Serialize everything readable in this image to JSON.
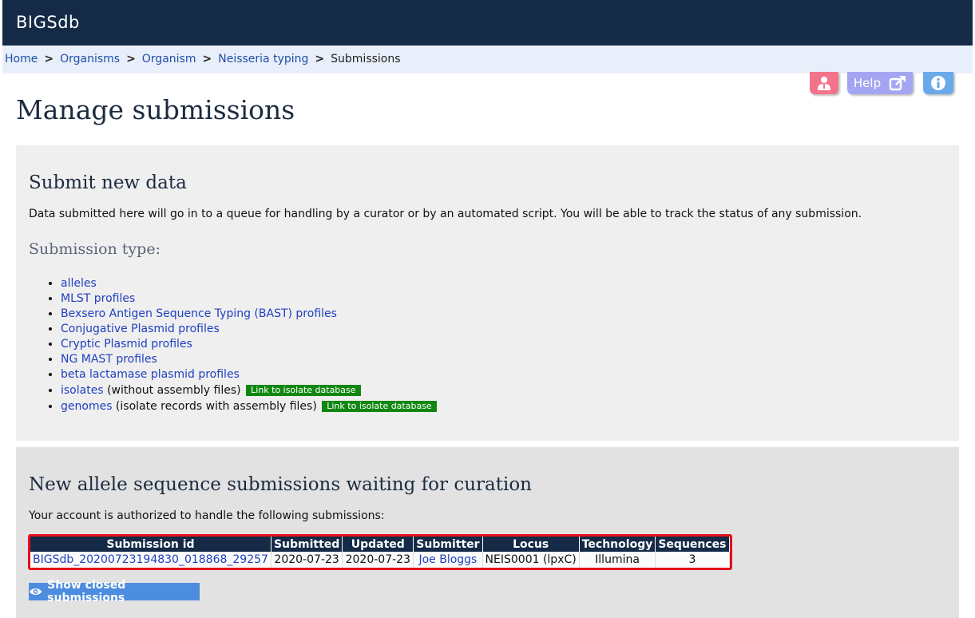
{
  "app": {
    "brand": "BIGSdb"
  },
  "breadcrumb": {
    "items": [
      "Home",
      "Organisms",
      "Organism",
      "Neisseria typing"
    ],
    "current": "Submissions",
    "separator": ">"
  },
  "toolbar": {
    "help_label": "Help",
    "icons": [
      "user-icon",
      "external-link-icon",
      "info-icon"
    ]
  },
  "page": {
    "title": "Manage submissions"
  },
  "submit": {
    "heading": "Submit new data",
    "description": "Data submitted here will go in to a queue for handling by a curator or by an automated script. You will be able to track the status of any submission.",
    "type_heading": "Submission type:",
    "types": [
      {
        "label": "alleles"
      },
      {
        "label": "MLST profiles"
      },
      {
        "label": "Bexsero Antigen Sequence Typing (BAST) profiles"
      },
      {
        "label": "Conjugative Plasmid profiles"
      },
      {
        "label": "Cryptic Plasmid profiles"
      },
      {
        "label": "NG MAST profiles"
      },
      {
        "label": "beta lactamase plasmid profiles"
      },
      {
        "label": "isolates",
        "note": " (without assembly files) ",
        "badge": "Link to isolate database"
      },
      {
        "label": "genomes",
        "note": " (isolate records with assembly files) ",
        "badge": "Link to isolate database"
      }
    ]
  },
  "pending": {
    "heading": "New allele sequence submissions waiting for curation",
    "description": "Your account is authorized to handle the following submissions:",
    "columns": [
      "Submission id",
      "Submitted",
      "Updated",
      "Submitter",
      "Locus",
      "Technology",
      "Sequences"
    ],
    "rows": [
      [
        "BIGSdb_20200723194830_018868_29257",
        "2020-07-23",
        "2020-07-23",
        "Joe Bloggs",
        "NEIS0001 (lpxC)",
        "Illumina",
        "3"
      ]
    ],
    "closed_button": "Show closed submissions"
  },
  "colors": {
    "header": "#142a47",
    "breadcrumb_bg": "#e8effa",
    "link": "#1f3fc0",
    "badge_green": "#118711",
    "highlight_red": "#e40f1a",
    "button_blue": "#4c8de0"
  }
}
